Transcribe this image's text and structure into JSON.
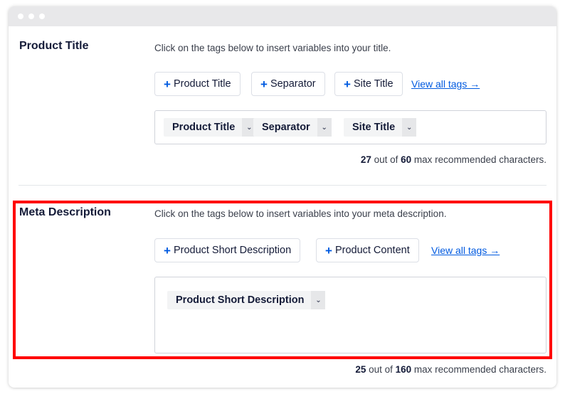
{
  "window": {
    "controls": [
      "window-dot",
      "window-dot",
      "window-dot"
    ]
  },
  "product_title": {
    "label": "Product Title",
    "hint": "Click on the tags below to insert variables into your title.",
    "add_buttons": [
      {
        "plus": "+",
        "label": "Product Title"
      },
      {
        "plus": "+",
        "label": "Separator"
      },
      {
        "plus": "+",
        "label": "Site Title"
      }
    ],
    "view_all": "View all tags →",
    "tags": [
      {
        "label": "Product Title",
        "caret": "⌄"
      },
      {
        "label": "Separator",
        "caret": "⌄"
      },
      {
        "label": "Site Title",
        "caret": "⌄"
      }
    ],
    "counter": {
      "count": "27",
      "middle": " out of ",
      "max": "60",
      "suffix": " max recommended characters."
    }
  },
  "meta_description": {
    "label": "Meta Description",
    "hint": "Click on the tags below to insert variables into your meta description.",
    "add_buttons": [
      {
        "plus": "+",
        "label": "Product Short Description"
      },
      {
        "plus": "+",
        "label": "Product Content"
      }
    ],
    "view_all": "View all tags →",
    "tags": [
      {
        "label": "Product Short Description",
        "caret": "⌄"
      }
    ],
    "counter": {
      "count": "25",
      "middle": " out of ",
      "max": "160",
      "suffix": " max recommended characters."
    },
    "highlight_color": "#ff0000"
  },
  "colors": {
    "accent": "#005ae0",
    "text": "#141b38",
    "highlight": "#ff0000"
  }
}
